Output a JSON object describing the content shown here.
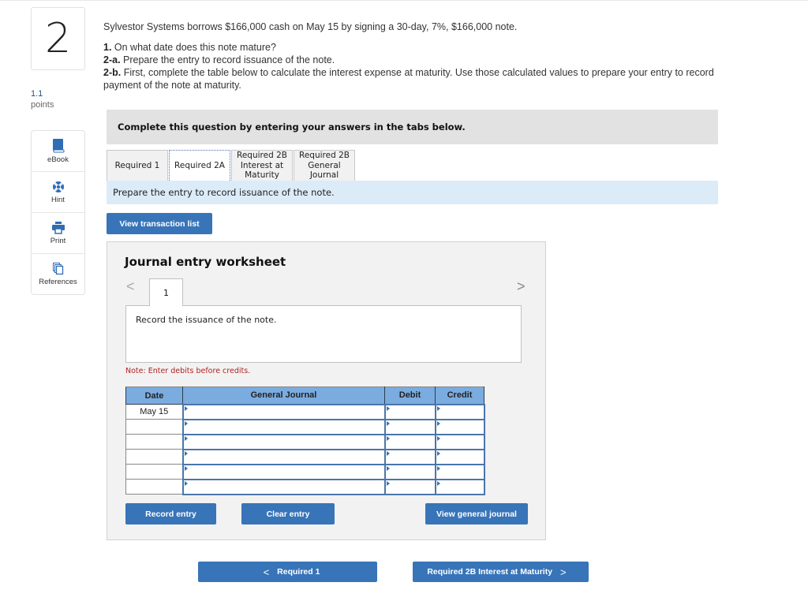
{
  "question": {
    "number": "2",
    "points_value": "1.1",
    "points_label": "points",
    "intro": "Sylvestor Systems borrows $166,000 cash on May 15 by signing a 30-day, 7%, $166,000 note.",
    "parts": [
      {
        "label": "1.",
        "text": " On what date does this note mature?"
      },
      {
        "label": "2-a.",
        "text": " Prepare the entry to record issuance of the note."
      },
      {
        "label": "2-b.",
        "text": " First, complete the table below to calculate the interest expense at maturity. Use those calculated values to prepare your entry to record payment of the note at maturity."
      }
    ]
  },
  "tools": [
    {
      "label": "eBook",
      "icon": "book-icon"
    },
    {
      "label": "Hint",
      "icon": "lifebuoy-icon"
    },
    {
      "label": "Print",
      "icon": "printer-icon"
    },
    {
      "label": "References",
      "icon": "documents-icon"
    }
  ],
  "banner": "Complete this question by entering your answers in the tabs below.",
  "tabs": [
    {
      "label": "Required 1",
      "active": false
    },
    {
      "label": "Required 2A",
      "active": true
    },
    {
      "label": "Required 2B Interest at Maturity",
      "active": false
    },
    {
      "label": "Required 2B General Journal",
      "active": false
    }
  ],
  "instruction": "Prepare the entry to record issuance of the note.",
  "view_transaction_list": "View transaction list",
  "worksheet": {
    "title": "Journal entry worksheet",
    "prev_glyph": "<",
    "next_glyph": ">",
    "entry_tab": "1",
    "description": "Record the issuance of the note.",
    "note": "Note: Enter debits before credits.",
    "columns": [
      "Date",
      "General Journal",
      "Debit",
      "Credit"
    ],
    "rows": [
      {
        "date": "May 15",
        "account": "",
        "debit": "",
        "credit": ""
      },
      {
        "date": "",
        "account": "",
        "debit": "",
        "credit": ""
      },
      {
        "date": "",
        "account": "",
        "debit": "",
        "credit": ""
      },
      {
        "date": "",
        "account": "",
        "debit": "",
        "credit": ""
      },
      {
        "date": "",
        "account": "",
        "debit": "",
        "credit": ""
      },
      {
        "date": "",
        "account": "",
        "debit": "",
        "credit": ""
      }
    ],
    "record_entry": "Record entry",
    "clear_entry": "Clear entry",
    "view_general_journal": "View general journal"
  },
  "nav": {
    "prev_label": "Required 1",
    "next_label": "Required 2B Interest at Maturity",
    "prev_glyph": "<",
    "next_glyph": ">"
  },
  "colors": {
    "button_blue": "#3874b8",
    "header_blue": "#7aace0",
    "instruction_bg": "#dcebf8",
    "note_red": "#b22222"
  }
}
